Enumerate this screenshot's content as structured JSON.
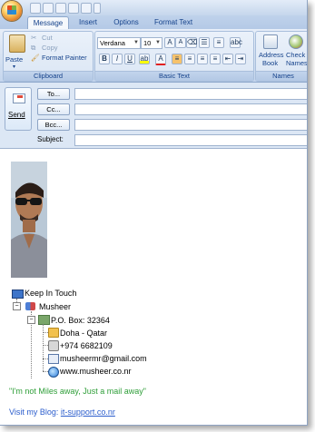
{
  "tabs": [
    "Message",
    "Insert",
    "Options",
    "Format Text"
  ],
  "ribbon": {
    "clipboard": {
      "paste": "Paste",
      "cut": "Cut",
      "copy": "Copy",
      "format_painter": "Format Painter",
      "label": "Clipboard"
    },
    "basic_text": {
      "font": "Verdana",
      "size": "10",
      "label": "Basic Text"
    },
    "names": {
      "address_book": "Address",
      "address_book_2": "Book",
      "check_names": "Check",
      "check_names_2": "Names",
      "label": "Names"
    }
  },
  "compose": {
    "send": "Send",
    "to": "To...",
    "cc": "Cc...",
    "bcc": "Bcc...",
    "subject": "Subject:"
  },
  "signature": {
    "keep_in_touch": "Keep In Touch",
    "name": "Musheer",
    "po_box": "P.O. Box: 32364",
    "city": "Doha - Qatar",
    "phone": "+974 6682109",
    "email": "musheermr@gmail.com",
    "website": "www.musheer.co.nr",
    "quote": "\"I'm not Miles away, Just a mail away\"",
    "blog_prefix": "Visit my Blog: ",
    "blog_link": "it-support.co.nr"
  },
  "colors": {
    "quote": "#2e9e38",
    "blog": "#2a5ccc",
    "ribbon_text": "#15428b"
  }
}
